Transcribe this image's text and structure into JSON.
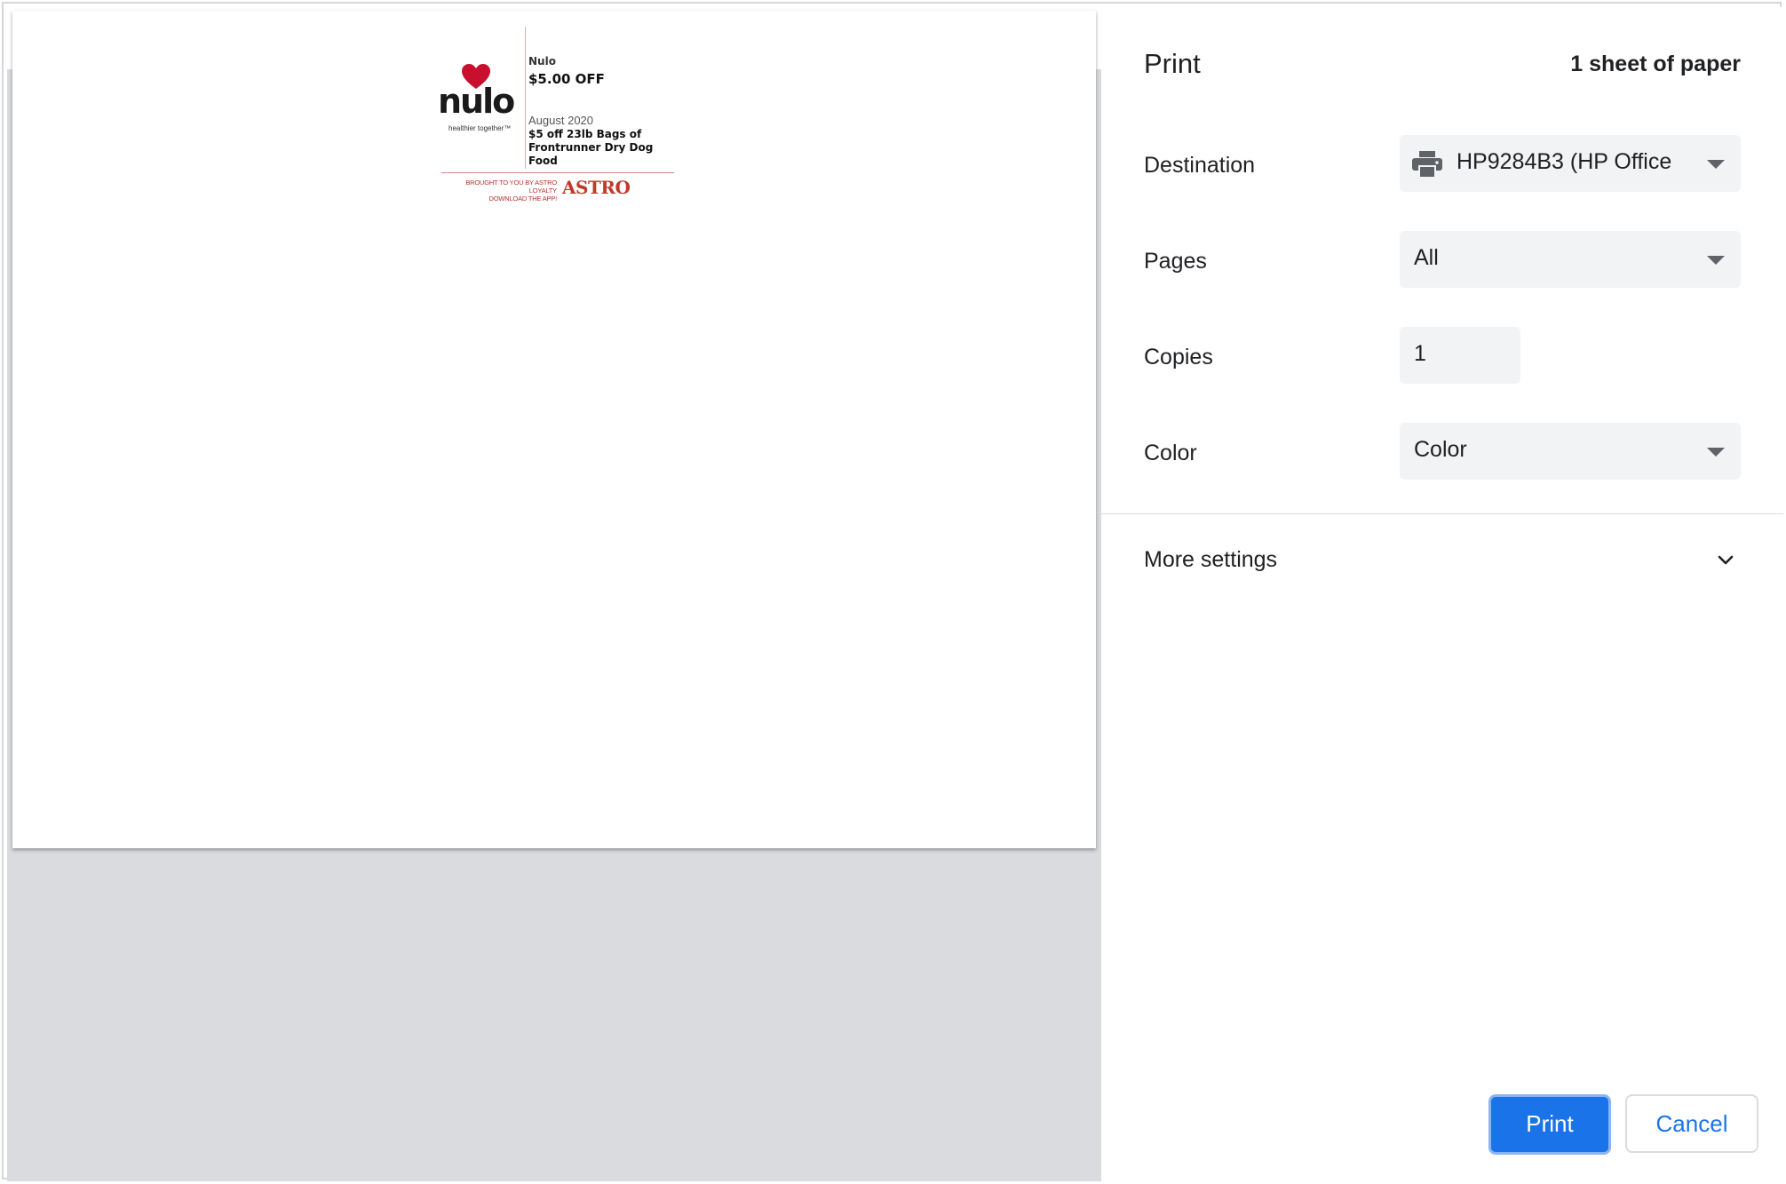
{
  "preview": {
    "coupon": {
      "logo_word": "nulo",
      "logo_tagline": "healthier together™",
      "brand": "Nulo",
      "offer": "$5.00 OFF",
      "date": "August 2020",
      "description": "$5 off 23lb Bags of Frontrunner Dry Dog Food",
      "footer_line1": "BROUGHT TO YOU BY ASTRO LOYALTY",
      "footer_line2": "DOWNLOAD THE APP!",
      "footer_brand": "ASTRO",
      "accent_color": "#c0392b"
    }
  },
  "sidebar": {
    "title": "Print",
    "sheet_count": "1 sheet of paper",
    "destination": {
      "label": "Destination",
      "value": "HP9284B3 (HP Office",
      "icon": "printer-icon"
    },
    "pages": {
      "label": "Pages",
      "value": "All"
    },
    "copies": {
      "label": "Copies",
      "value": "1"
    },
    "color": {
      "label": "Color",
      "value": "Color"
    },
    "more_settings": {
      "label": "More settings",
      "icon": "chevron-down-icon"
    },
    "buttons": {
      "print": "Print",
      "cancel": "Cancel"
    },
    "accent_color": "#1a73e8"
  }
}
